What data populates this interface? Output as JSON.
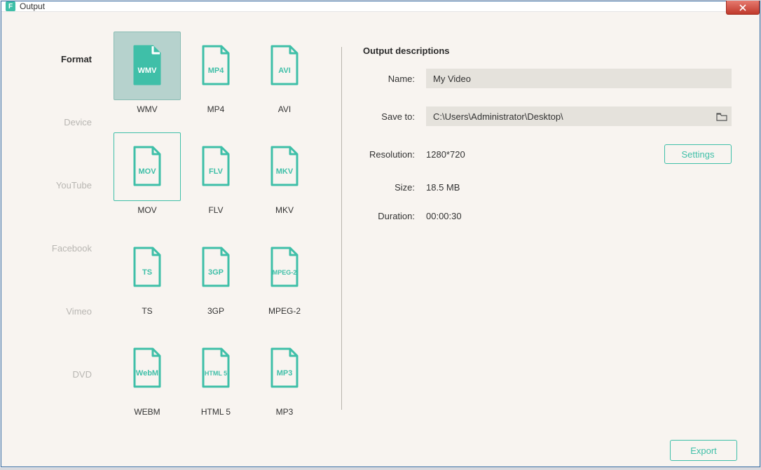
{
  "window": {
    "title": "Output"
  },
  "sidebar": {
    "items": [
      {
        "label": "Format",
        "active": true
      },
      {
        "label": "Device"
      },
      {
        "label": "YouTube"
      },
      {
        "label": "Facebook"
      },
      {
        "label": "Vimeo"
      },
      {
        "label": "DVD"
      }
    ]
  },
  "formats": [
    {
      "code": "WMV",
      "label": "WMV",
      "state": "selected"
    },
    {
      "code": "MP4",
      "label": "MP4"
    },
    {
      "code": "AVI",
      "label": "AVI"
    },
    {
      "code": "MOV",
      "label": "MOV",
      "state": "hover"
    },
    {
      "code": "FLV",
      "label": "FLV"
    },
    {
      "code": "MKV",
      "label": "MKV"
    },
    {
      "code": "TS",
      "label": "TS"
    },
    {
      "code": "3GP",
      "label": "3GP"
    },
    {
      "code": "MPEG-2",
      "label": "MPEG-2"
    },
    {
      "code": "WebM",
      "label": "WEBM"
    },
    {
      "code": "HTML 5",
      "label": "HTML 5"
    },
    {
      "code": "MP3",
      "label": "MP3"
    }
  ],
  "details": {
    "heading": "Output descriptions",
    "name_label": "Name:",
    "name_value": "My Video",
    "saveto_label": "Save to:",
    "saveto_value": "C:\\Users\\Administrator\\Desktop\\",
    "resolution_label": "Resolution:",
    "resolution_value": "1280*720",
    "settings_label": "Settings",
    "size_label": "Size:",
    "size_value": "18.5 MB",
    "duration_label": "Duration:",
    "duration_value": "00:00:30"
  },
  "footer": {
    "export_label": "Export"
  },
  "colors": {
    "accent": "#3fbfa8"
  }
}
